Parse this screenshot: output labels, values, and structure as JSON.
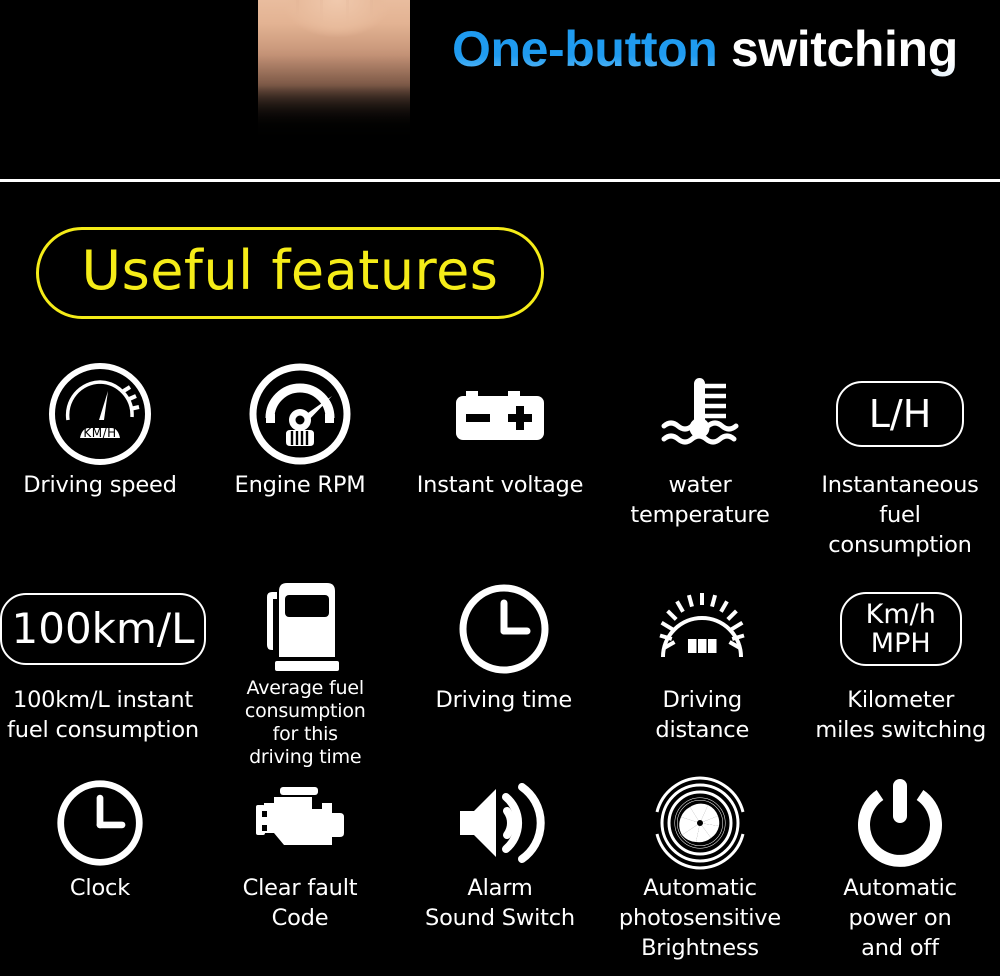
{
  "header": {
    "title_blue": "One-button",
    "title_white": " switching",
    "blue_color": "#1F9BF0",
    "hand_icon": "pointing-hand-photo"
  },
  "heading": {
    "text": "Useful features",
    "accent_color": "#F5EC18"
  },
  "features": {
    "rows": [
      [
        {
          "icon": "speedometer-kmh-icon",
          "label": "Driving speed"
        },
        {
          "icon": "tachometer-rpm-icon",
          "label": "Engine RPM"
        },
        {
          "icon": "car-battery-icon",
          "label": "Instant voltage"
        },
        {
          "icon": "coolant-temperature-icon",
          "label": "water\ntemperature"
        },
        {
          "icon": "l-per-h-badge-icon",
          "badge_text": "L/H",
          "label": "Instantaneous\nfuel\nconsumption"
        }
      ],
      [
        {
          "icon": "hundred-km-per-l-badge-icon",
          "badge_text": "100km/L",
          "label": "100km/L instant\nfuel consumption"
        },
        {
          "icon": "fuel-pump-icon",
          "label": "Average fuel\nconsumption\nfor this\ndriving time"
        },
        {
          "icon": "clock-icon",
          "label": "Driving time"
        },
        {
          "icon": "odometer-icon",
          "label": "Driving\ndistance"
        },
        {
          "icon": "kmh-mph-badge-icon",
          "badge_text_line1": "Km/h",
          "badge_text_line2": "MPH",
          "label": "Kilometer\nmiles switching"
        }
      ],
      [
        {
          "icon": "clock-icon",
          "label": "Clock"
        },
        {
          "icon": "engine-check-icon",
          "label": "Clear fault\nCode"
        },
        {
          "icon": "speaker-volume-icon",
          "label": "Alarm\nSound Switch"
        },
        {
          "icon": "camera-aperture-icon",
          "label": "Automatic\nphotosensitive\nBrightness"
        },
        {
          "icon": "power-icon",
          "label": "Automatic\npower on\nand off"
        }
      ]
    ]
  }
}
